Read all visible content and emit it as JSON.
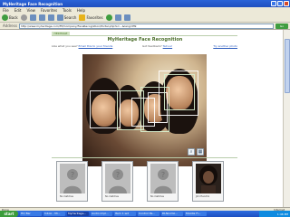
{
  "window": {
    "title": "MyHeritage Face Recognition"
  },
  "menu": [
    "File",
    "Edit",
    "View",
    "Favorites",
    "Tools",
    "Help"
  ],
  "toolbar": {
    "back": "Back",
    "search": "Search",
    "favorites": "Favorites"
  },
  "address": {
    "label": "Address",
    "url": "http://www.myheritage.com/FP/Company/FaceRecognition/Portal.php?s=...&lang=EN",
    "go": "Go"
  },
  "page": {
    "brand_tab": "HERITAGE",
    "title": "MyHeritage Face Recognition",
    "subhead_left": "Like what you see?",
    "subhead_left_link": "Email this to your friends",
    "subhead_mid": "Got feedback?",
    "subhead_mid_link": "Tell us!",
    "subhead_right_link": "Try another photo"
  },
  "results": [
    {
      "caption": "No matches"
    },
    {
      "caption": "No matches"
    },
    {
      "caption": "No matches"
    },
    {
      "caption": "Jimi Hendrix"
    }
  ],
  "status": {
    "left": "Done",
    "zone": "Internet"
  },
  "taskbar": {
    "start": "start",
    "items": [
      "HQ Bar",
      "Inbox - Mi...",
      "MyHeritage...",
      "Audio impl...",
      "Item 1.wd",
      "Control Pa...",
      "DLNA-DLI...",
      "Mozilla Fi..."
    ],
    "clock": "1:46 PM"
  },
  "colors": {
    "accent_green": "#4b6e2a",
    "link": "#2b5bbd"
  }
}
